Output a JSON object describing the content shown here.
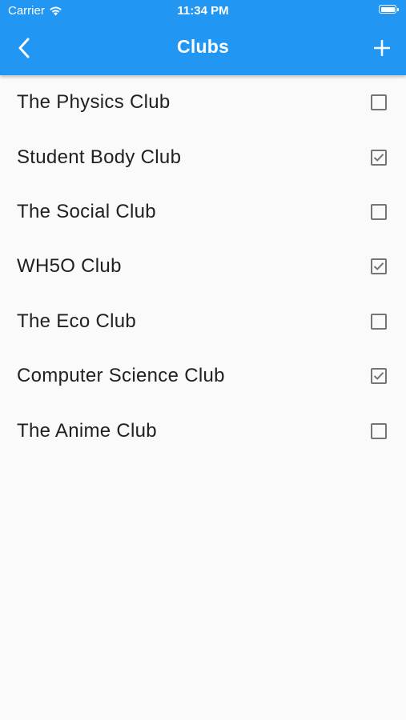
{
  "status_bar": {
    "carrier": "Carrier",
    "time": "11:34 PM",
    "wifi_icon": "wifi-icon",
    "battery_icon": "battery-icon"
  },
  "app_bar": {
    "title": "Clubs",
    "back_icon": "chevron-left-icon",
    "add_icon": "plus-icon",
    "color": "#2196f3"
  },
  "clubs": [
    {
      "name": "The Physics Club",
      "checked": false
    },
    {
      "name": "Student Body Club",
      "checked": true
    },
    {
      "name": "The Social Club",
      "checked": false
    },
    {
      "name": "WH5O Club",
      "checked": true
    },
    {
      "name": "The Eco Club",
      "checked": false
    },
    {
      "name": "Computer Science Club",
      "checked": true
    },
    {
      "name": "The Anime Club",
      "checked": false
    }
  ]
}
